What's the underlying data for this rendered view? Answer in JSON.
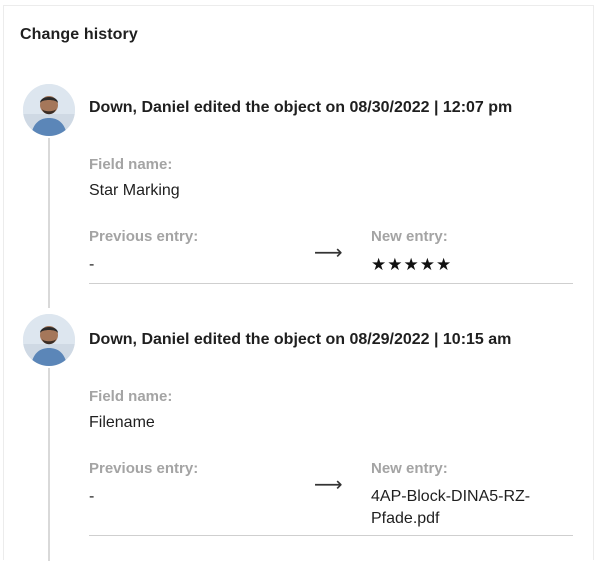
{
  "panel": {
    "title": "Change history"
  },
  "entries": [
    {
      "header": "Down, Daniel edited the object on 08/30/2022 | 12:07 pm",
      "field_label": "Field name:",
      "field_value": "Star Marking",
      "previous_label": "Previous entry:",
      "previous_value": "-",
      "new_label": "New entry:",
      "new_value": "★★★★★",
      "arrow": "⟶"
    },
    {
      "header": "Down, Daniel edited the object on 08/29/2022 | 10:15 am",
      "field_label": "Field name:",
      "field_value": "Filename",
      "previous_label": "Previous entry:",
      "previous_value": "-",
      "new_label": "New entry:",
      "new_value": "4AP-Block-DINA5-RZ-Pfade.pdf",
      "arrow": "⟶"
    }
  ],
  "colors": {
    "timeline": "#d9d9d9",
    "muted_label": "#a4a4a4",
    "divider": "#cfcfcf"
  }
}
